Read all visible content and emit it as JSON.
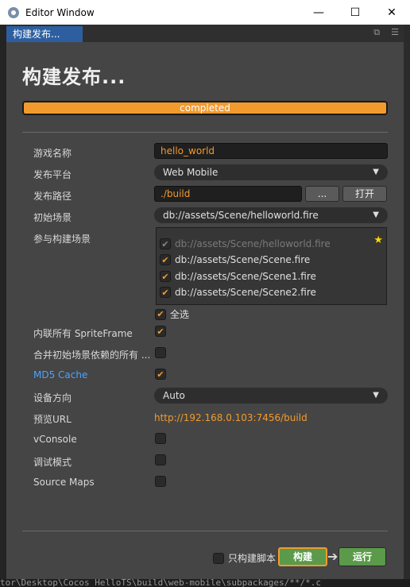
{
  "window": {
    "title": "Editor Window",
    "minimize": "—",
    "maximize": "☐",
    "close": "✕"
  },
  "panel": {
    "tab_label": "构建发布...",
    "heading": "构建发布..."
  },
  "progress": {
    "label": "completed",
    "value": 1.0
  },
  "form": {
    "game_name_label": "游戏名称",
    "game_name_value": "hello_world",
    "platform_label": "发布平台",
    "platform_value": "Web Mobile",
    "build_path_label": "发布路径",
    "build_path_value": "./build",
    "browse_label": "...",
    "open_label": "打开",
    "start_scene_label": "初始场景",
    "start_scene_value": "db://assets/Scene/helloworld.fire",
    "included_scenes_label": "参与构建场景",
    "scenes": [
      {
        "path": "db://assets/Scene/helloworld.fire",
        "checked": true,
        "disabled": true
      },
      {
        "path": "db://assets/Scene/Scene.fire",
        "checked": true,
        "disabled": false
      },
      {
        "path": "db://assets/Scene/Scene1.fire",
        "checked": true,
        "disabled": false
      },
      {
        "path": "db://assets/Scene/Scene2.fire",
        "checked": true,
        "disabled": false
      }
    ],
    "select_all_label": "全选",
    "inline_spriteframe_label": "内联所有 SpriteFrame",
    "merge_start_scene_label": "合并初始场景依赖的所有 ...",
    "md5_cache_label": "MD5 Cache",
    "orientation_label": "设备方向",
    "orientation_value": "Auto",
    "preview_url_label": "预览URL",
    "preview_url_value": "http://192.168.0.103:7456/build",
    "vconsole_label": "vConsole",
    "debug_label": "调试模式",
    "source_maps_label": "Source Maps"
  },
  "footer": {
    "build_script_only_label": "只构建脚本",
    "build_label": "构建",
    "run_label": "运行",
    "arrow": "➔"
  },
  "background_console": "tor\\Desktop\\Cocos_HelloTS\\build\\web-mobile\\subpackages/**/*.c",
  "colors": {
    "accent": "#f29a2e",
    "tab_active": "#2d5fa0",
    "build_green": "#5a9a4a",
    "link_blue": "#4aa3ff"
  }
}
